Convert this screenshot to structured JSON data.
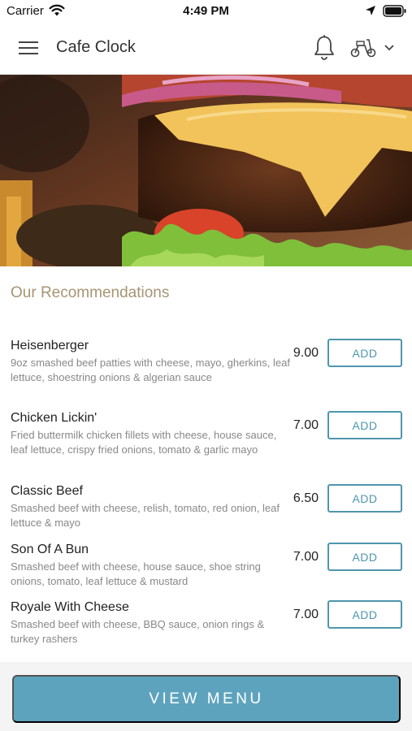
{
  "status_bar": {
    "carrier": "Carrier",
    "time": "4:49 PM"
  },
  "header": {
    "title": "Cafe Clock",
    "icons": [
      "hamburger-menu-icon",
      "bell-icon",
      "scooter-icon",
      "chevron-down-icon"
    ]
  },
  "section": {
    "title": "Our Recommendations"
  },
  "items": [
    {
      "name": "Heisenberger",
      "desc": "9oz smashed beef patties with cheese, mayo, gherkins, leaf lettuce, shoestring onions & algerian sauce",
      "price": "9.00",
      "add_label": "ADD"
    },
    {
      "name": "Chicken Lickin'",
      "desc": "Fried buttermilk chicken fillets with cheese, house sauce, leaf lettuce, crispy fried onions, tomato & garlic mayo",
      "price": "7.00",
      "add_label": "ADD"
    },
    {
      "name": "Classic Beef",
      "desc": "Smashed beef with cheese, relish, tomato, red onion, leaf lettuce & mayo",
      "price": "6.50",
      "add_label": "ADD"
    },
    {
      "name": "Son Of A Bun",
      "desc": "Smashed beef with cheese, house sauce, shoe string onions, tomato, leaf lettuce & mustard",
      "price": "7.00",
      "add_label": "ADD"
    },
    {
      "name": "Royale With Cheese",
      "desc": "Smashed beef with cheese, BBQ sauce, onion rings & turkey rashers",
      "price": "7.00",
      "add_label": "ADD"
    }
  ],
  "footer": {
    "view_menu_label": "VIEW MENU"
  },
  "colors": {
    "accent": "#5ea3bd",
    "button_border": "#4e96ad",
    "section_title": "#a69573"
  }
}
